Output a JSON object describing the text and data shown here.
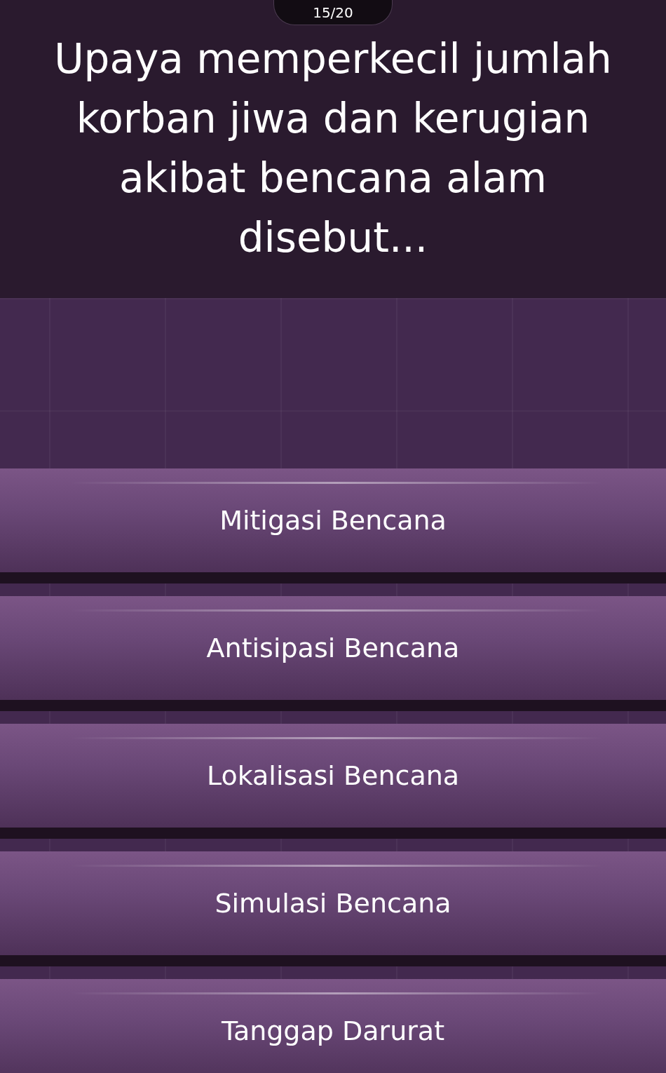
{
  "counter": "15/20",
  "question": "Upaya memperkecil jumlah korban jiwa dan kerugian akibat bencana alam disebut...",
  "options": [
    {
      "label": "Mitigasi Bencana"
    },
    {
      "label": "Antisipasi Bencana"
    },
    {
      "label": "Lokalisasi Bencana"
    },
    {
      "label": "Simulasi Bencana"
    },
    {
      "label": "Tanggap Darurat"
    }
  ]
}
